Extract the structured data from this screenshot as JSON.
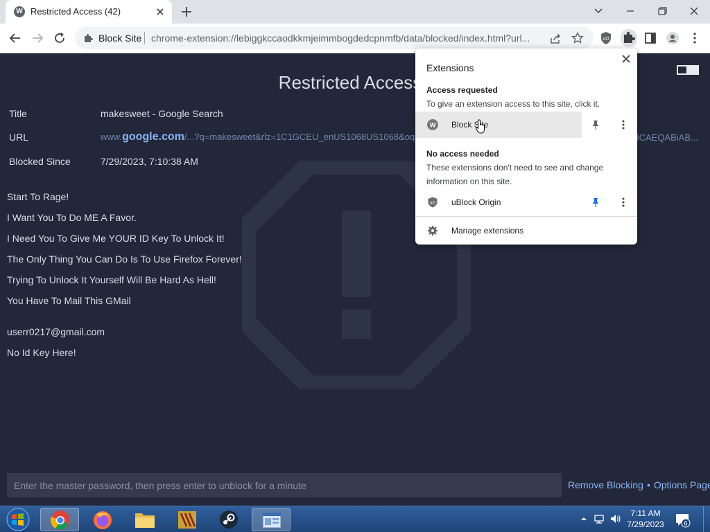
{
  "browser": {
    "tab_title": "Restricted Access (42)",
    "tab_favicon_letter": "W",
    "omnibox_chip": "Block Site",
    "omnibox_url": "chrome-extension://lebiggkccaodkkmjeimmbogdedcpnmfb/data/blocked/index.html?url..."
  },
  "page": {
    "title": "Restricted Access",
    "labels": {
      "title": "Title",
      "url": "URL",
      "blocked_since": "Blocked Since"
    },
    "values": {
      "title": "makesweet - Google Search",
      "url_prefix": "www.",
      "url_domain": "google.com",
      "url_rest": "/...?q=makesweet&rlz=1C1GCEU_enUS1068US1068&oq",
      "url_tail": "ICAEQABiAB...",
      "blocked_since": "7/29/2023, 7:10:38 AM"
    },
    "messages": [
      "Start To Rage!",
      "I Want You To Do ME A Favor.",
      "I Need You To Give Me YOUR ID Key To Unlock It!",
      "The Only Thing You Can Do Is To Use Firefox Forever!",
      "Trying To Unlock It Yourself Will Be Hard As Hell!",
      "You Have To Mail This GMail"
    ],
    "email": "userr0217@gmail.com",
    "no_key": "No Id Key Here!",
    "password_placeholder": "Enter the master password, then press enter to unblock for a minute",
    "remove_blocking": "Remove Blocking",
    "separator": "•",
    "options_page": "Options Page"
  },
  "extensions_popup": {
    "title": "Extensions",
    "access_requested": "Access requested",
    "access_requested_desc": "To give an extension access to this site, click it.",
    "block_site": "Block Site",
    "block_site_icon_letter": "W",
    "no_access_needed": "No access needed",
    "no_access_desc": "These extensions don't need to see and change information on this site.",
    "ublock": "uBlock Origin",
    "manage": "Manage extensions"
  },
  "taskbar": {
    "time": "7:11 AM",
    "date": "7/29/2023",
    "notifications_count": "6"
  },
  "colors": {
    "page_bg": "#222839",
    "link": "#8ab4f8",
    "pin_active": "#1a73e8"
  }
}
